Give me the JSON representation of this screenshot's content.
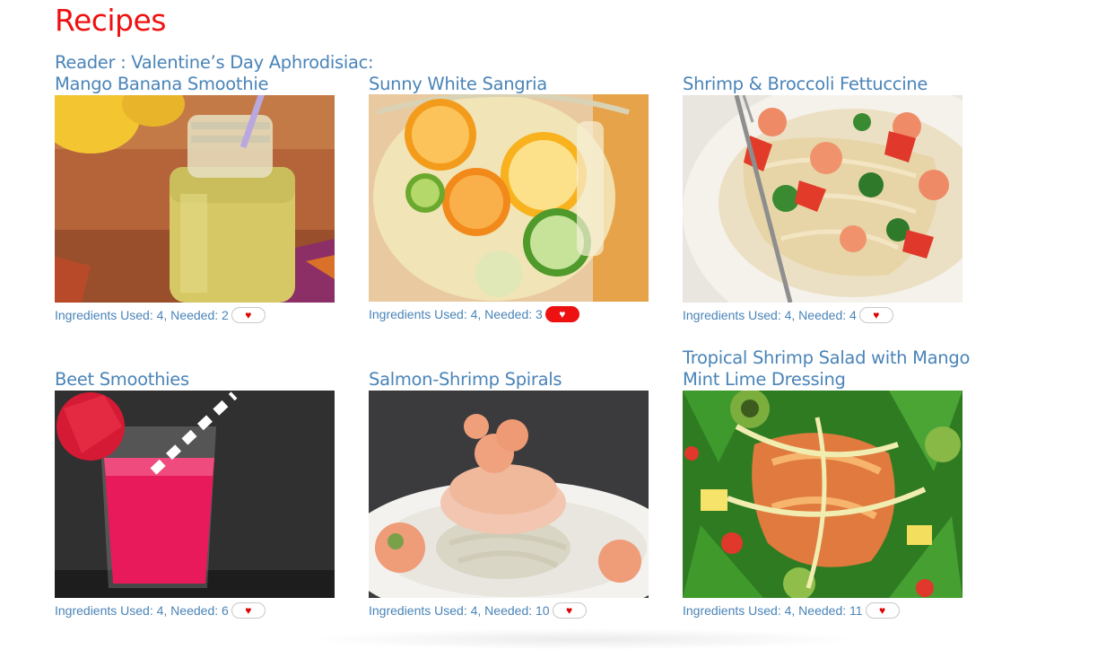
{
  "page": {
    "title": "Recipes"
  },
  "recipes": [
    {
      "title_line1": "Reader : Valentine’s Day Aphrodisiac:",
      "title_line2": "Mango Banana Smoothie",
      "meta": "Ingredients Used: 4, Needed: 2",
      "favorite": false,
      "image": "mango-banana-smoothie"
    },
    {
      "title_line1": "Sunny White Sangria",
      "title_line2": "",
      "meta": "Ingredients Used: 4, Needed: 3",
      "favorite": true,
      "image": "sunny-white-sangria"
    },
    {
      "title_line1": "Shrimp & Broccoli Fettuccine",
      "title_line2": "",
      "meta": "Ingredients Used: 4, Needed: 4",
      "favorite": false,
      "image": "shrimp-broccoli-fettuccine"
    },
    {
      "title_line1": "Beet Smoothies",
      "title_line2": "",
      "meta": "Ingredients Used: 4, Needed: 6",
      "favorite": false,
      "image": "beet-smoothies"
    },
    {
      "title_line1": "Salmon-Shrimp Spirals",
      "title_line2": "",
      "meta": "Ingredients Used: 4, Needed: 10",
      "favorite": false,
      "image": "salmon-shrimp-spirals"
    },
    {
      "title_line1": "Tropical Shrimp Salad with Mango",
      "title_line2": "Mint Lime Dressing",
      "meta": "Ingredients Used: 4, Needed: 11",
      "favorite": false,
      "image": "tropical-shrimp-salad"
    }
  ],
  "icons": {
    "favorite": "heart-icon",
    "favorite_glyph": "♥"
  },
  "colors": {
    "title_red": "#ee1111",
    "link_blue": "#4a84b8",
    "favorite_active": "#ee1111"
  }
}
